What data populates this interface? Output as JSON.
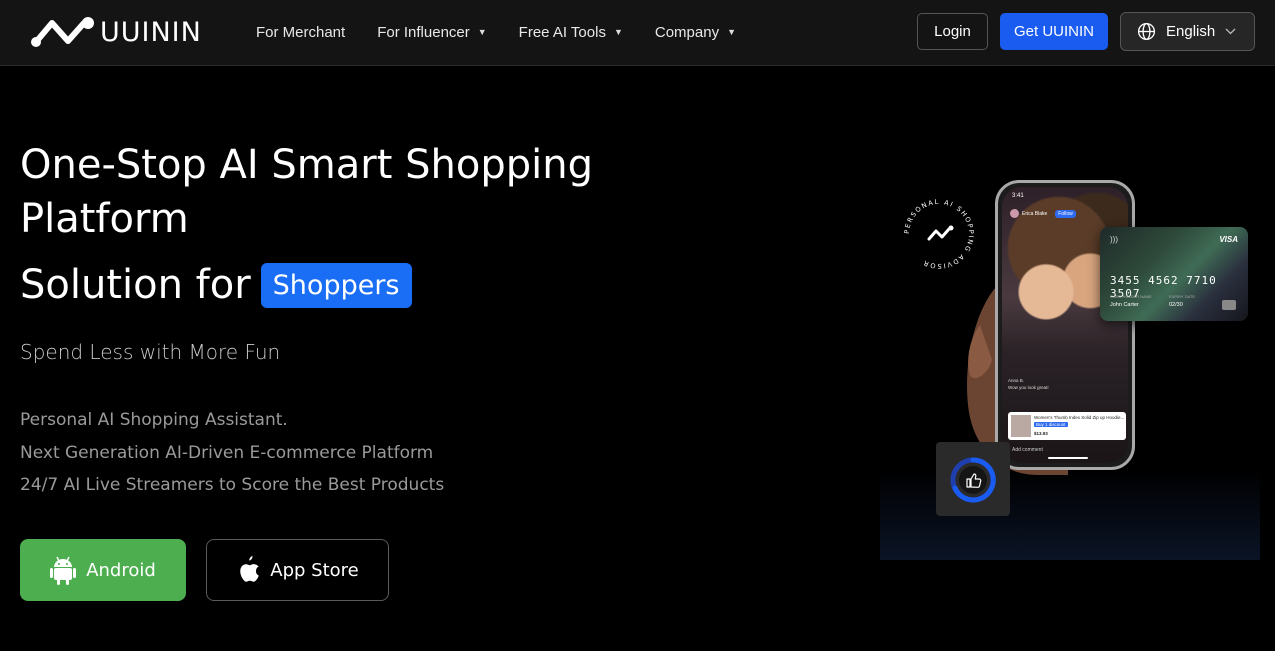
{
  "nav": {
    "brand": "UUININ",
    "links": [
      {
        "label": "For Merchant",
        "dropdown": false
      },
      {
        "label": "For Influencer",
        "dropdown": true
      },
      {
        "label": "Free AI Tools",
        "dropdown": true
      },
      {
        "label": "Company",
        "dropdown": true
      }
    ],
    "login_label": "Login",
    "get_label": "Get UUININ",
    "language": "English"
  },
  "hero": {
    "title_line1": "One-Stop AI Smart Shopping Platform",
    "solution_prefix": "Solution for",
    "solution_highlight": "Shoppers",
    "tagline": "Spend Less with More Fun",
    "features": [
      "Personal AI Shopping Assistant.",
      "Next Generation AI-Driven E-commerce Platform",
      "24/7 AI Live Streamers to Score the Best Products"
    ],
    "android_label": "Android",
    "appstore_label": "App Store"
  },
  "visual": {
    "badge_text": "PERSONAL AI SHOPPING ADVISOR",
    "phone_time": "3:41",
    "phone_user": "Erica Blake",
    "phone_follow": "Follow",
    "phone_comment_1": "Anna B.",
    "phone_comment_2": "Wow you look great!",
    "product_title": "Women's Thumb Index Solid Zip up Hoodie...",
    "product_tag": "Buy 1 discount",
    "product_price": "$13.93",
    "add_comment": "Add comment",
    "card_brand": "VISA",
    "card_number": "3455 4562 7710 3507",
    "card_label_holder": "CARD HOLDER NAME",
    "card_label_expiry": "EXPIRY DATE",
    "card_holder": "John Carter",
    "card_expiry": "02/30"
  },
  "colors": {
    "accent_blue": "#1a6df5",
    "android_green": "#4cae4f",
    "background": "#000000",
    "nav_background": "#141414"
  },
  "icons": {
    "logo": "uuinin-logo-icon",
    "globe": "globe-icon",
    "chevron": "chevron-down-icon",
    "android": "android-icon",
    "apple": "apple-icon",
    "like": "thumbs-up-icon"
  }
}
